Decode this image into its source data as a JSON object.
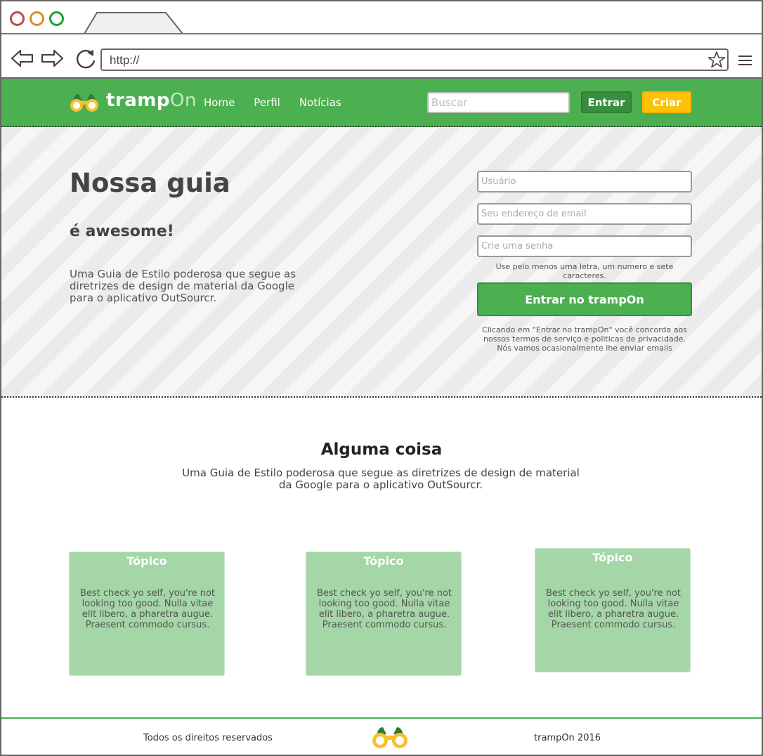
{
  "browser": {
    "url": "http://",
    "colors": {
      "close": "#c2474e",
      "minimize": "#d8902a",
      "maximize": "#1f9e2f"
    },
    "icons": [
      "back-arrow-icon",
      "forward-arrow-icon",
      "reload-icon",
      "star-icon",
      "menu-icon"
    ]
  },
  "header": {
    "brand_bold": "tramp",
    "brand_light": "On",
    "nav": [
      "Home",
      "Perfil",
      "Notícias"
    ],
    "search_placeholder": "Buscar",
    "login_label": "Entrar",
    "create_label": "Criar",
    "colors": {
      "primary": "#4caf50",
      "accent": "#ffc107"
    }
  },
  "hero": {
    "title": "Nossa guia",
    "subtitle": "é awesome!",
    "text": "Uma Guia de Estilo poderosa que segue as diretrizes de design de material da Google para o aplicativo OutSourcr."
  },
  "signup": {
    "username_placeholder": "Usuário",
    "email_placeholder": "Seu endereço de email",
    "password_placeholder": "Crie uma senha",
    "password_hint": "Use pelo menos uma letra, um numero e sete caracteres.",
    "submit_label": "Entrar no trampOn",
    "terms": "Clicando em \"Entrar no trampOn\" você concorda aos nossos termos de  serviço e politicas de privacidade. Nós vamos ocasionalmente lhe enviar emails"
  },
  "section": {
    "title": "Alguma coisa",
    "text": "Uma Guia de Estilo poderosa que segue as diretrizes de design de material da Google para o aplicativo OutSourcr."
  },
  "cards": [
    {
      "title": "Tópico",
      "text": "Best check yo self, you're not looking too good. Nulla vitae elit libero, a pharetra augue. Praesent commodo cursus."
    },
    {
      "title": "Tópico",
      "text": "Best check yo self, you're not looking too good. Nulla vitae elit libero, a pharetra augue. Praesent commodo cursus."
    },
    {
      "title": "Tópico",
      "text": "Best check yo self, you're not looking too good. Nulla vitae elit libero, a pharetra augue. Praesent commodo cursus."
    }
  ],
  "footer": {
    "left": "Todos os direitos reservados",
    "right": "trampOn 2016"
  }
}
